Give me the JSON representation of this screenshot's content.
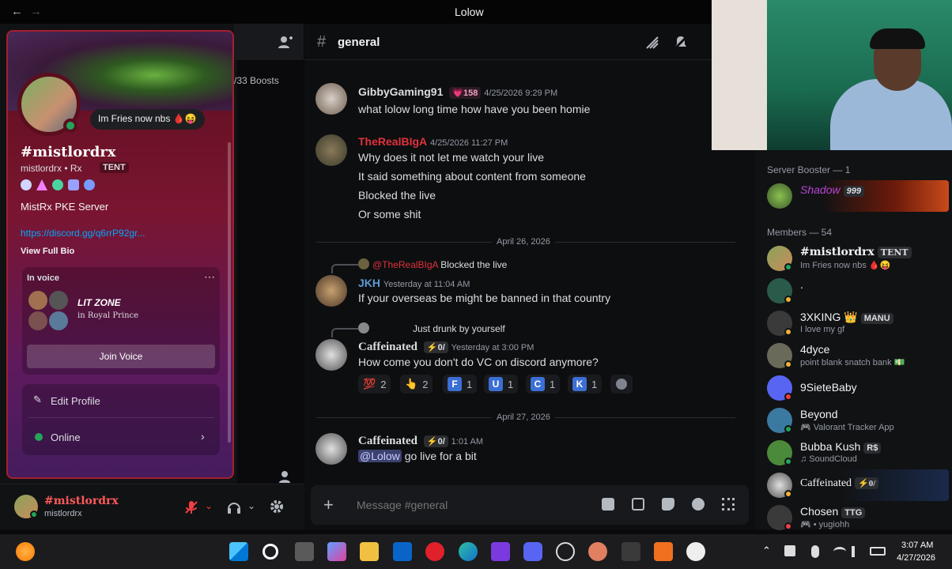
{
  "window": {
    "title": "Lolow",
    "back_icon": "←",
    "forward_icon": "→"
  },
  "server": {
    "boosts": "/33 Boosts"
  },
  "channel": {
    "name": "general"
  },
  "messages": [
    {
      "author": "GibbyGaming91",
      "badge": "158",
      "time": "4/25/2026 9:29 PM",
      "lines": [
        "what lolow long time how have you been homie"
      ],
      "color": "#dbdee1"
    },
    {
      "author": "TheRealBIgA",
      "time": "4/25/2026 11:27 PM",
      "lines": [
        "Why does it not let me watch your live",
        "It said something about content from someone",
        "Blocked the live",
        "Or some shit"
      ],
      "color": "#e0323c"
    },
    {
      "reply_author": "@TheRealBIgA",
      "reply_text": "Blocked the live",
      "author": "JKH",
      "time": "Yesterday at 11:04 AM",
      "lines": [
        "If your overseas be might be banned in that country"
      ],
      "color": "#5b9bd5"
    },
    {
      "reply_text": "Just drunk by yourself",
      "author": "Caffeinated",
      "tag": "⚡0/",
      "time": "Yesterday at 3:00 PM",
      "lines": [
        "How come you don't do VC on discord anymore?"
      ],
      "color": "#dbdee1"
    },
    {
      "author": "Caffeinated",
      "tag": "⚡0/",
      "time": "1:01 AM",
      "mention": "@Lolow",
      "lines": [
        "go live for a bit"
      ],
      "color": "#dbdee1"
    }
  ],
  "dividers": [
    "April 26, 2026",
    "April 27, 2026"
  ],
  "reactions": [
    {
      "emoji": "💯",
      "count": "2"
    },
    {
      "emoji": "👆",
      "count": "2"
    },
    {
      "emoji": "F",
      "count": "1"
    },
    {
      "emoji": "U",
      "count": "1"
    },
    {
      "emoji": "C",
      "count": "1"
    },
    {
      "emoji": "K",
      "count": "1"
    }
  ],
  "composer": {
    "placeholder": "Message #general"
  },
  "user": {
    "display": "#mistlordrx",
    "username": "mistlordrx"
  },
  "profile": {
    "status": "Im Fries now nbs 🩸😝",
    "display": "#mistlordrx",
    "username": "mistlordrx • Rx",
    "tag": "TENT",
    "server": "MistRx PKE Server",
    "link": "https://discord.gg/q6rrP92gr...",
    "view_bio": "View Full Bio",
    "in_voice": "In voice",
    "vc_name": "LIT ZONE",
    "vc_server": "in Royal Prince",
    "join": "Join Voice",
    "edit": "Edit Profile",
    "online": "Online"
  },
  "members": {
    "booster_header": "Server Booster — 1",
    "booster": {
      "name": "Shadow",
      "tag": "999"
    },
    "members_header": "Members — 54",
    "list": [
      {
        "name": "#mistlordrx",
        "tag": "TENT",
        "status": "Im Fries now nbs 🩸😝"
      },
      {
        "name": ".",
        "tag": "",
        "status": ""
      },
      {
        "name": "3XKING 👑",
        "tag": "MANU",
        "status": "I love my gf"
      },
      {
        "name": "4dyce",
        "tag": "",
        "status": "point blank snatch bank 💵"
      },
      {
        "name": "9SieteBaby",
        "tag": "",
        "status": ""
      },
      {
        "name": "Beyond",
        "tag": "",
        "status": "🎮 Valorant Tracker App"
      },
      {
        "name": "Bubba Kush",
        "tag": "R$",
        "status": "♫ SoundCloud"
      },
      {
        "name": "Caffeinated",
        "tag": "⚡0/",
        "status": ""
      },
      {
        "name": "Chosen",
        "tag": "TTG",
        "status": "🎮 • yugiohh"
      }
    ]
  },
  "clock": {
    "time": "3:07 AM",
    "date": "4/27/2026"
  }
}
